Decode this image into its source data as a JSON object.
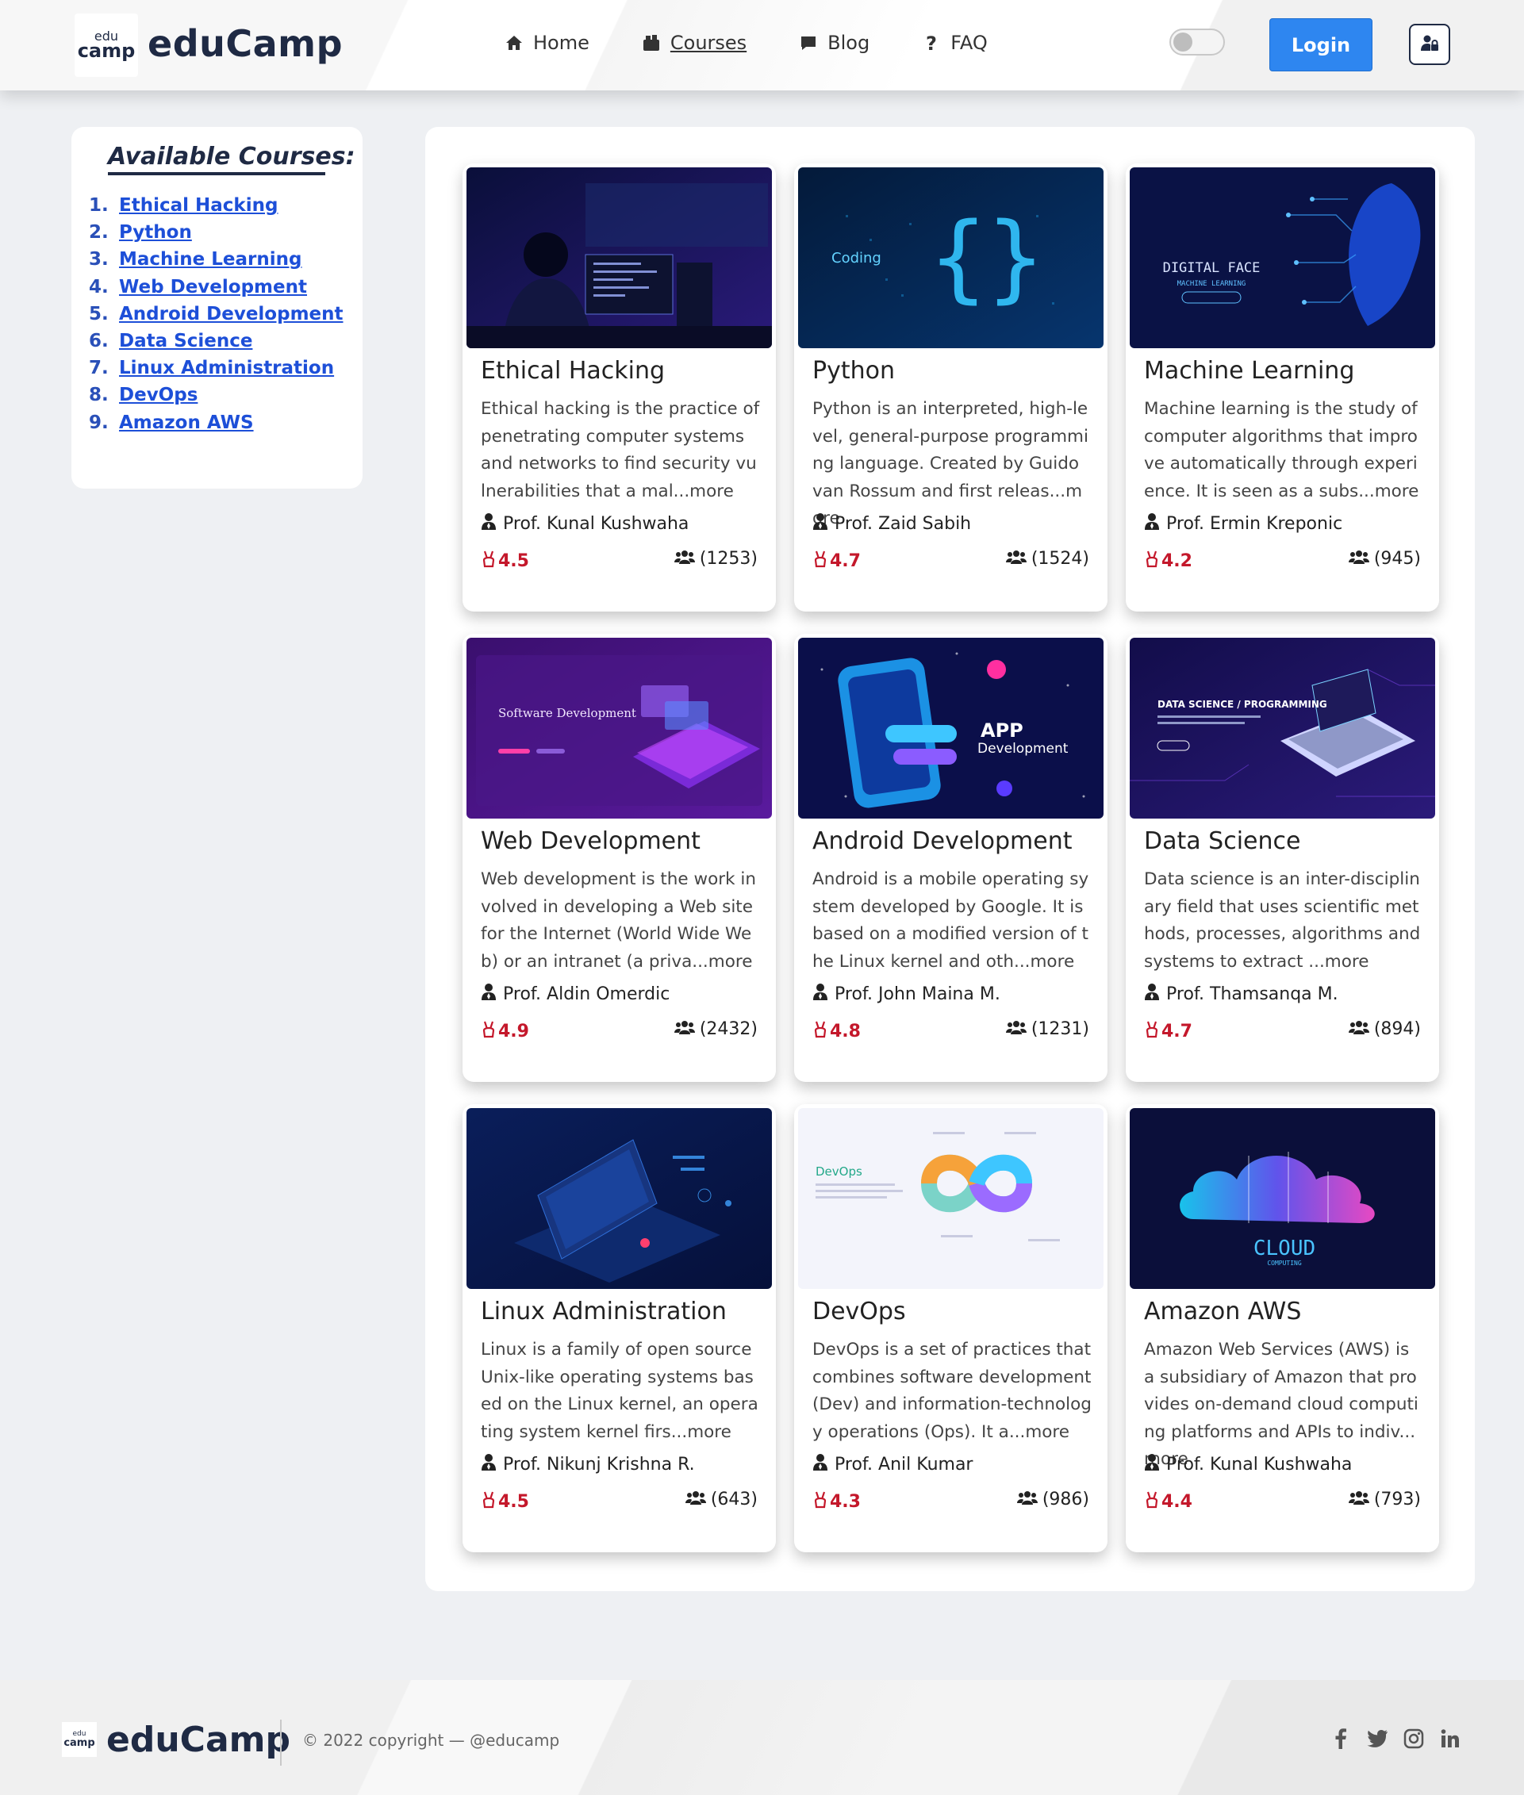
{
  "header": {
    "logo": {
      "line1": "edu",
      "line2": "camp"
    },
    "brand": "eduCamp",
    "nav": [
      {
        "label": "Home",
        "icon": "home-icon"
      },
      {
        "label": "Courses",
        "icon": "courses-icon",
        "active": true
      },
      {
        "label": "Blog",
        "icon": "comment-icon"
      },
      {
        "label": "FAQ",
        "icon": "question-icon"
      }
    ],
    "theme_toggle": {
      "state": "off"
    },
    "login_label": "Login",
    "user_icon": "user-lock-icon"
  },
  "sidebar": {
    "title": "Available Courses:",
    "items": [
      {
        "num": "1.",
        "label": "Ethical Hacking"
      },
      {
        "num": "2.",
        "label": "Python"
      },
      {
        "num": "3.",
        "label": "Machine Learning"
      },
      {
        "num": "4.",
        "label": "Web Development"
      },
      {
        "num": "5.",
        "label": "Android Development"
      },
      {
        "num": "6.",
        "label": "Data Science"
      },
      {
        "num": "7.",
        "label": "Linux Administration"
      },
      {
        "num": "8.",
        "label": "DevOps"
      },
      {
        "num": "9.",
        "label": "Amazon AWS"
      }
    ]
  },
  "courses": [
    {
      "title": "Ethical Hacking",
      "description": "Ethical hacking is the practice of penetrating computer systems and networks to find security vulnerabilities that a mal...more",
      "professor": "Prof. Kunal Kushwaha",
      "rating": "4.5",
      "enrolled": "(1253)",
      "image": {
        "theme": "hacker-at-desk",
        "caption": "",
        "subcaption": ""
      }
    },
    {
      "title": "Python",
      "description": "Python is an interpreted, high-level, general-purpose programming language. Created by Guido van Rossum and first releas...more",
      "professor": "Prof. Zaid Sabih",
      "rating": "4.7",
      "enrolled": "(1524)",
      "image": {
        "theme": "coding-braces",
        "caption": "Coding",
        "subcaption": ""
      }
    },
    {
      "title": "Machine Learning",
      "description": "Machine learning is the study of computer algorithms that improve automatically through experience. It is seen as a subs...more",
      "professor": "Prof. Ermin Kreponic",
      "rating": "4.2",
      "enrolled": "(945)",
      "image": {
        "theme": "digital-face",
        "caption": "DIGITAL FACE",
        "subcaption": "MACHINE LEARNING"
      }
    },
    {
      "title": "Web Development",
      "description": "Web development is the work involved in developing a Web site for the Internet (World Wide Web) or an intranet (a priva...more",
      "professor": "Prof. Aldin Omerdic",
      "rating": "4.9",
      "enrolled": "(2432)",
      "image": {
        "theme": "software-dev",
        "caption": "Software Development",
        "subcaption": ""
      }
    },
    {
      "title": "Android Development",
      "description": "Android is a mobile operating system developed by Google. It is based on a modified version of the Linux kernel and oth...more",
      "professor": "Prof. John Maina M.",
      "rating": "4.8",
      "enrolled": "(1231)",
      "image": {
        "theme": "app-phone",
        "caption": "APP",
        "subcaption": "Development"
      }
    },
    {
      "title": "Data Science",
      "description": "Data science is an inter-disciplinary field that uses scientific methods, processes, algorithms and systems to extract ...more",
      "professor": "Prof. Thamsanqa M.",
      "rating": "4.7",
      "enrolled": "(894)",
      "image": {
        "theme": "laptop-data",
        "caption": "DATA SCIENCE / PROGRAMMING",
        "subcaption": ""
      }
    },
    {
      "title": "Linux Administration",
      "description": "Linux is a family of open source Unix-like operating systems based on the Linux kernel, an operating system kernel firs...more",
      "professor": "Prof. Nikunj Krishna R.",
      "rating": "4.5",
      "enrolled": "(643)",
      "image": {
        "theme": "laptop-dark",
        "caption": "",
        "subcaption": ""
      }
    },
    {
      "title": "DevOps",
      "description": "DevOps is a set of practices that combines software development (Dev) and information-technology operations (Ops). It a...more",
      "professor": "Prof. Anil Kumar",
      "rating": "4.3",
      "enrolled": "(986)",
      "image": {
        "theme": "devops-loop",
        "caption": "DevOps",
        "subcaption": ""
      }
    },
    {
      "title": "Amazon AWS",
      "description": "Amazon Web Services (AWS) is a subsidiary of Amazon that provides on-demand cloud computing platforms and APIs to indiv...more",
      "professor": "Prof. Kunal Kushwaha",
      "rating": "4.4",
      "enrolled": "(793)",
      "image": {
        "theme": "cloud",
        "caption": "CLOUD",
        "subcaption": "COMPUTING"
      }
    }
  ],
  "footer": {
    "logo": {
      "line1": "edu",
      "line2": "camp"
    },
    "brand": "eduCamp",
    "copyright": "© 2022 copyright — @educamp",
    "socials": [
      "facebook-icon",
      "twitter-icon",
      "instagram-icon",
      "linkedin-icon"
    ]
  },
  "colors": {
    "accent": "#2e86f0",
    "brand_dark": "#1f2a44",
    "link": "#1d4fd8",
    "rating": "#c4182b"
  }
}
